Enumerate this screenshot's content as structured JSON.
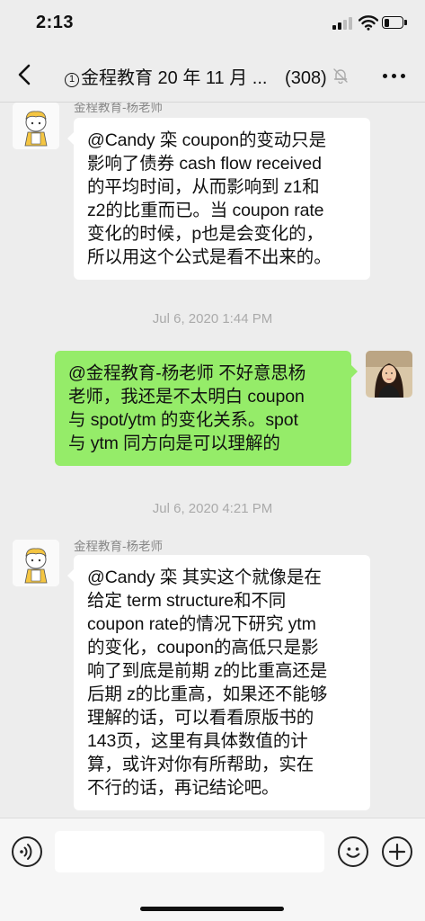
{
  "status_bar": {
    "time": "2:13",
    "battery_level": 0.3
  },
  "header": {
    "back_icon": "chevron-left-icon",
    "title_badge": "1",
    "title": "金程教育 20 年 11 月 ...",
    "member_count": "(308)",
    "mute_icon": "bell-slash-icon",
    "more_icon": "ellipsis-icon"
  },
  "messages": [
    {
      "type": "incoming",
      "sender": "金程教育-杨老师",
      "lines": [
        "@Candy 栾 coupon的变动只是",
        "影响了债券 cash flow received",
        "的平均时间，从而影响到 z1和",
        "z2的比重而已。当 coupon rate",
        "变化的时候，p也是会变化的，",
        "所以用这个公式是看不出来的。"
      ]
    },
    {
      "type": "timestamp",
      "text": "Jul 6, 2020 1:44 PM"
    },
    {
      "type": "outgoing",
      "lines": [
        "@金程教育-杨老师 不好意思杨",
        "老师，我还是不太明白 coupon",
        "与 spot/ytm 的变化关系。spot",
        "与 ytm 同方向是可以理解的"
      ]
    },
    {
      "type": "timestamp",
      "text": "Jul 6, 2020 4:21 PM"
    },
    {
      "type": "incoming",
      "sender": "金程教育-杨老师",
      "lines": [
        "@Candy 栾 其实这个就像是在",
        "给定 term structure和不同",
        "coupon rate的情况下研究 ytm",
        "的变化，coupon的高低只是影",
        "响了到底是前期 z的比重高还是",
        "后期 z的比重高，如果还不能够",
        "理解的话，可以看看原版书的",
        "143页，这里有具体数值的计",
        "算，或许对你有所帮助，实在",
        "不行的话，再记结论吧。"
      ]
    }
  ],
  "input_bar": {
    "voice_icon": "voice-icon",
    "input_value": "",
    "emoji_icon": "emoji-icon",
    "plus_icon": "plus-icon"
  },
  "colors": {
    "background": "#ededed",
    "outgoing_bubble": "#95ec69",
    "incoming_bubble": "#ffffff",
    "meta_text": "#aaaaaa"
  }
}
